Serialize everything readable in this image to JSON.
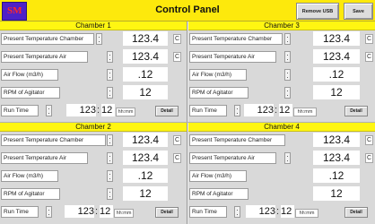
{
  "window": {
    "title": "Control Panel",
    "logo_text": "SM",
    "buttons": {
      "remove_usb": "Remove USB",
      "save": "Save"
    }
  },
  "labels": {
    "present_temp_chamber": "Present Temperature Chamber",
    "present_temp_air": "Present Temperature Air",
    "air_flow": "Air Flow (m3/h)",
    "rpm_agitator": "RPM of Agitator",
    "run_time": "Run Time",
    "temp_unit": "C",
    "time_separator": ":",
    "time_unit": "hh:mm",
    "detail_button": "Detail"
  },
  "chambers": [
    {
      "name": "Chamber 1",
      "temp_chamber": "123.4",
      "temp_air": "123.4",
      "air_flow": ".12",
      "rpm": "12",
      "run_hours": "123",
      "run_minutes": "12"
    },
    {
      "name": "Chamber 3",
      "temp_chamber": "123.4",
      "temp_air": "123.4",
      "air_flow": ".12",
      "rpm": "12",
      "run_hours": "123",
      "run_minutes": "12"
    },
    {
      "name": "Chamber 2",
      "temp_chamber": "123.4",
      "temp_air": "123.4",
      "air_flow": ".12",
      "rpm": "12",
      "run_hours": "123",
      "run_minutes": "12"
    },
    {
      "name": "Chamber 4",
      "temp_chamber": "123.4",
      "temp_air": "123.4",
      "air_flow": ".12",
      "rpm": "12",
      "run_hours": "123",
      "run_minutes": "12"
    }
  ],
  "colors": {
    "title_bar": "#fde90c",
    "panel_header": "#fff612",
    "logo_bg": "#4e22c7",
    "logo_text": "#ff2a2a"
  }
}
